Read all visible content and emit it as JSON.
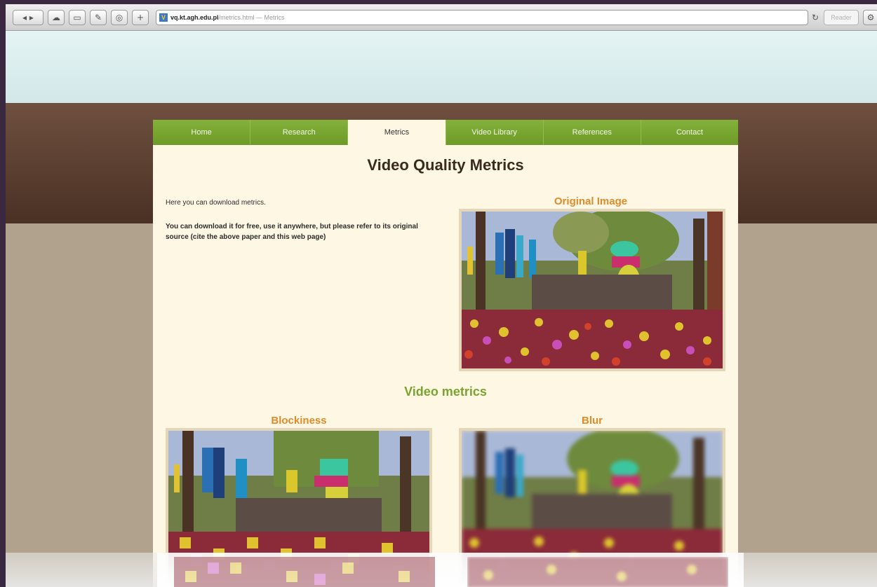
{
  "browser": {
    "url_host": "vq.kt.agh.edu.pl",
    "url_path": "/metrics.html",
    "url_separator": " — ",
    "page_title": "Metrics",
    "reader_label": "Reader",
    "buttons": {
      "back": "◂",
      "forward": "▸",
      "icloud": "☁",
      "bookmarks": "▭",
      "tools": "✎",
      "topsites": "◎",
      "add": "+",
      "reload": "↻",
      "settings": "⚙"
    }
  },
  "nav": {
    "items": [
      {
        "label": "Home"
      },
      {
        "label": "Research"
      },
      {
        "label": "Metrics"
      },
      {
        "label": "Video Library"
      },
      {
        "label": "References"
      },
      {
        "label": "Contact"
      }
    ],
    "active_index": 2
  },
  "main": {
    "title": "Video Quality Metrics",
    "intro": "Here you can download metrics.",
    "note": "You can download it for free, use it anywhere, but please refer to its original source (cite the above paper and this web page)",
    "original_label": "Original Image",
    "section_heading": "Video metrics",
    "blockiness_label": "Blockiness",
    "blur_label": "Blur"
  },
  "colors": {
    "nav_green": "#7aa430",
    "label_orange": "#df8b2a",
    "panel_bg": "#fdf7e3",
    "header_brown": "#5a3d2f"
  }
}
